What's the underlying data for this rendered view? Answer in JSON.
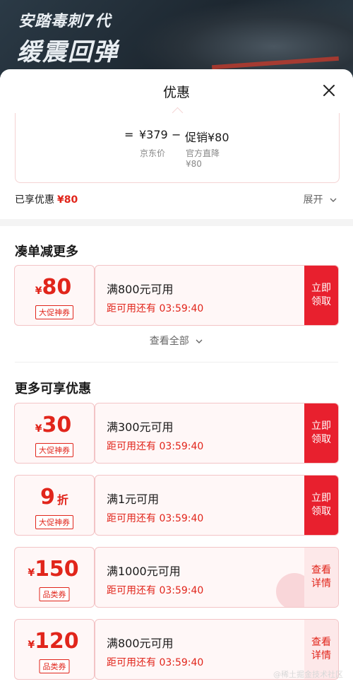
{
  "banner": {
    "line1": "安踏毒刺7代",
    "line2": "缓震回弹"
  },
  "sheet": {
    "title": "优惠"
  },
  "calc": {
    "equals": "=",
    "price": "¥379",
    "minus": "−",
    "promo": "促销¥80",
    "price_caption": "京东价",
    "promo_caption_1": "官方直降",
    "promo_caption_2": "¥80"
  },
  "enjoyed": {
    "label": "已享优惠",
    "amount": "¥80",
    "expand_label": "展开"
  },
  "section1": {
    "title": "凑单减更多",
    "coupons": [
      {
        "symbol": "¥",
        "value": "80",
        "unit": "",
        "tag": "大促神券",
        "condition": "满800元可用",
        "timer": "距可用还有 03:59:40",
        "action_1": "立即",
        "action_2": "领取"
      }
    ],
    "view_all": "查看全部"
  },
  "section2": {
    "title": "更多可享优惠",
    "coupons": [
      {
        "symbol": "¥",
        "value": "30",
        "unit": "",
        "tag": "大促神券",
        "condition": "满300元可用",
        "timer": "距可用还有 03:59:40",
        "action_1": "立即",
        "action_2": "领取"
      },
      {
        "symbol": "",
        "value": "9",
        "unit": "折",
        "tag": "大促神券",
        "condition": "满1元可用",
        "timer": "距可用还有 03:59:40",
        "action_1": "立即",
        "action_2": "领取"
      },
      {
        "symbol": "¥",
        "value": "150",
        "unit": "",
        "tag": "品类券",
        "condition": "满1000元可用",
        "timer": "距可用还有 03:59:40",
        "action_1": "查看",
        "action_2": "详情"
      },
      {
        "symbol": "¥",
        "value": "120",
        "unit": "",
        "tag": "品类券",
        "condition": "满800元可用",
        "timer": "距可用还有 03:59:40",
        "action_1": "查看",
        "action_2": "详情"
      }
    ]
  },
  "colors": {
    "accent": "#e1251b",
    "button": "#e8202e",
    "coupon_bg": "#fff7f7",
    "coupon_border": "#f3c4c6"
  },
  "icons": {
    "close": "close-icon",
    "expand": "chevron-down-icon"
  },
  "watermark": "@稀土掘金技术社区"
}
